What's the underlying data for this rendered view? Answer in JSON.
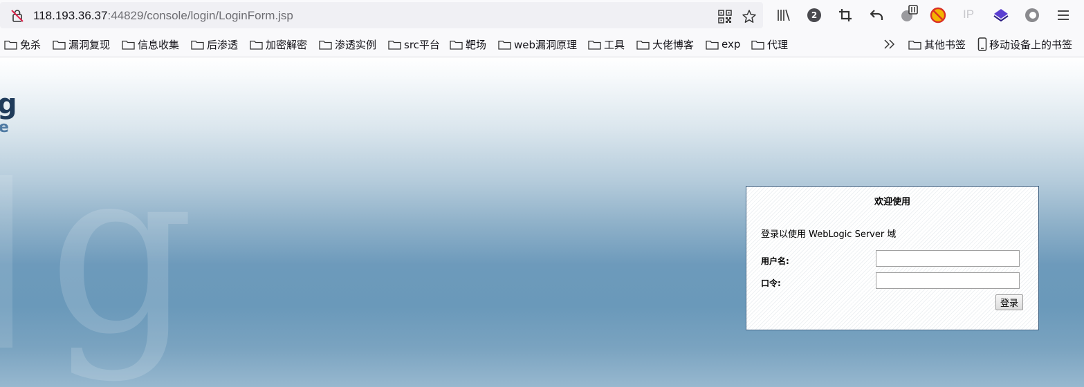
{
  "browser": {
    "url_host": "118.193.36.37",
    "url_path": ":44829/console/login/LoginForm.jsp",
    "extension_badge": "2",
    "ip_label": "IP"
  },
  "bookmarks": {
    "items": [
      {
        "label": "免杀"
      },
      {
        "label": "漏洞复现"
      },
      {
        "label": "信息收集"
      },
      {
        "label": "后渗透"
      },
      {
        "label": "加密解密"
      },
      {
        "label": "渗透实例"
      },
      {
        "label": "src平台"
      },
      {
        "label": "靶场"
      },
      {
        "label": "web漏洞原理"
      },
      {
        "label": "工具"
      },
      {
        "label": "大佬博客"
      },
      {
        "label": "exp"
      },
      {
        "label": "代理"
      }
    ],
    "other": "其他书签",
    "mobile": "移动设备上的书签"
  },
  "page": {
    "logo_letter": "g",
    "logo_sub_letter": "e",
    "watermark_letter": "g"
  },
  "login": {
    "title": "欢迎使用",
    "description": "登录以使用 WebLogic Server 域",
    "username_label": "用户名:",
    "username_value": "",
    "password_label": "口令:",
    "password_value": "",
    "submit_label": "登录"
  }
}
